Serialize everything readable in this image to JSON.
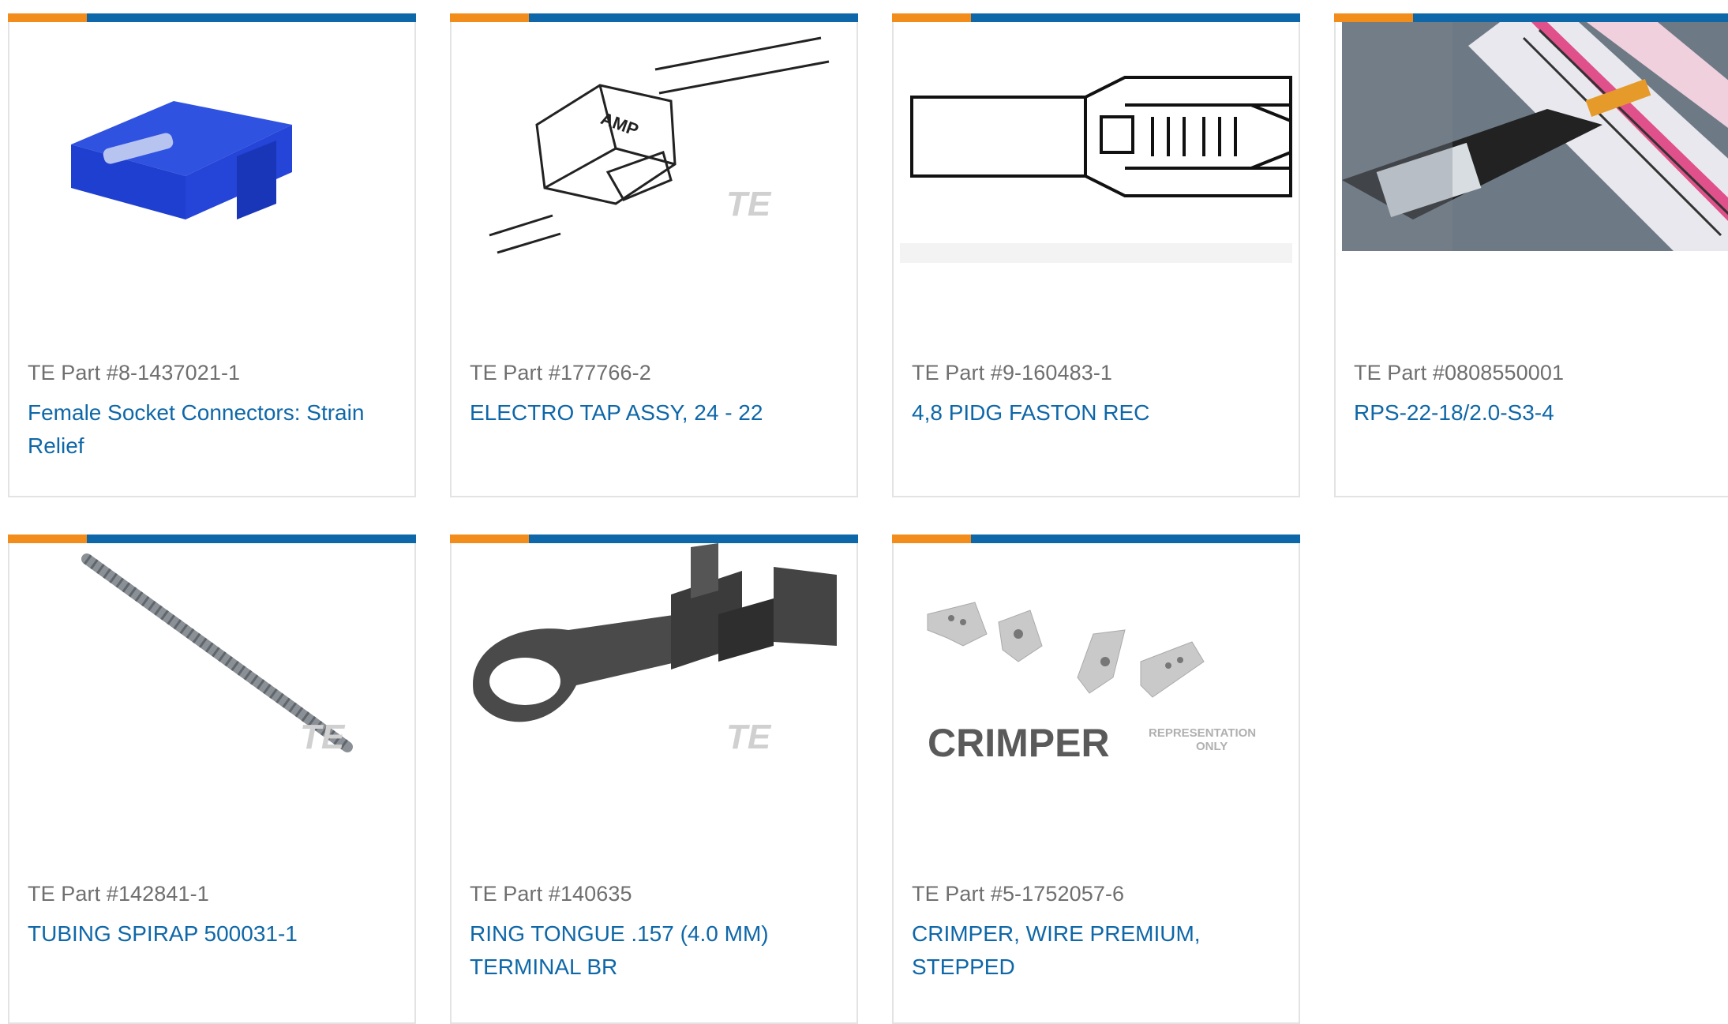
{
  "products": [
    {
      "part": "TE Part #8-1437021-1",
      "title": "Female Socket Connectors: Strain Relief",
      "image_icon": "strain-relief-image"
    },
    {
      "part": "TE Part #177766-2",
      "title": "ELECTRO TAP ASSY, 24 - 22",
      "image_icon": "electro-tap-image"
    },
    {
      "part": "TE Part #9-160483-1",
      "title": "4,8 PIDG FASTON REC",
      "image_icon": "faston-receptacle-image"
    },
    {
      "part": "TE Part #0808550001",
      "title": "RPS-22-18/2.0-S3-4",
      "image_icon": "marker-sleeve-photo"
    },
    {
      "part": "TE Part #142841-1",
      "title": "TUBING SPIRAP 500031-1",
      "image_icon": "spiral-tubing-image"
    },
    {
      "part": "TE Part #140635",
      "title": "RING TONGUE .157 (4.0 MM) TERMINAL BR",
      "image_icon": "ring-terminal-image"
    },
    {
      "part": "TE Part #5-1752057-6",
      "title": "CRIMPER, WIRE PREMIUM, STEPPED",
      "image_icon": "crimper-image"
    }
  ],
  "image_text": {
    "brand_mark": "TE",
    "amp_label": "AMP",
    "crimper_label": "CRIMPER",
    "representation_label": "REPRESENTATION",
    "only_label": "ONLY"
  },
  "colors": {
    "accent_orange": "#f28c1b",
    "accent_blue": "#0e67a8",
    "link": "#0e67a8",
    "part_text": "#6f6f6f"
  }
}
